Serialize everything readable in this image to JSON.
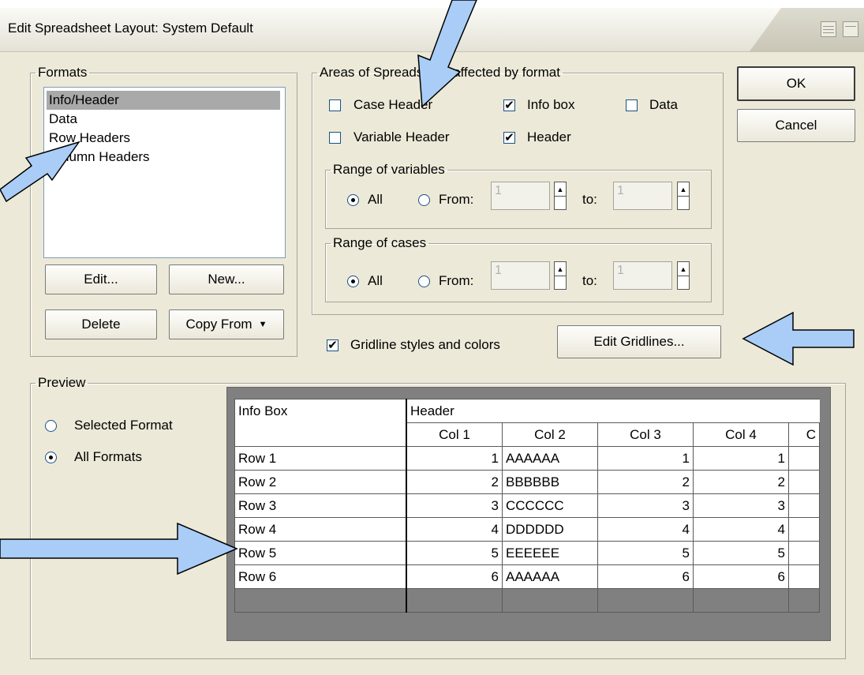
{
  "window": {
    "title": "Edit Spreadsheet Layout: System Default"
  },
  "formats": {
    "legend": "Formats",
    "items": [
      "Info/Header",
      "Data",
      "Row Headers",
      "Column Headers"
    ],
    "selected_index": 0,
    "buttons": {
      "edit": "Edit...",
      "new": "New...",
      "delete": "Delete",
      "copy_from": "Copy From"
    }
  },
  "areas": {
    "legend": "Areas of Spreadsheet affected by format",
    "checkboxes": [
      {
        "label": "Case Header",
        "checked": false
      },
      {
        "label": "Info box",
        "checked": true
      },
      {
        "label": "Data",
        "checked": false
      },
      {
        "label": "Variable Header",
        "checked": false
      },
      {
        "label": "Header",
        "checked": true
      }
    ],
    "range_variables": {
      "legend": "Range of variables",
      "all": "All",
      "from": "From:",
      "to": "to:",
      "from_value": "1",
      "to_value": "1"
    },
    "range_cases": {
      "legend": "Range of cases",
      "all": "All",
      "from": "From:",
      "to": "to:",
      "from_value": "1",
      "to_value": "1"
    }
  },
  "gridline": {
    "label": "Gridline styles and colors",
    "checked": true,
    "edit_button": "Edit Gridlines..."
  },
  "dialog_buttons": {
    "ok": "OK",
    "cancel": "Cancel"
  },
  "preview": {
    "legend": "Preview",
    "options": [
      "Selected Format",
      "All Formats"
    ],
    "selected_option": 1,
    "info_box": "Info Box",
    "header": "Header",
    "columns": [
      "Col 1",
      "Col 2",
      "Col 3",
      "Col 4",
      "C"
    ],
    "rows": [
      {
        "label": "Row 1",
        "c1": "1",
        "c2": "AAAAAA",
        "c3": "1",
        "c4": "1"
      },
      {
        "label": "Row 2",
        "c1": "2",
        "c2": "BBBBBB",
        "c3": "2",
        "c4": "2"
      },
      {
        "label": "Row 3",
        "c1": "3",
        "c2": "CCCCCC",
        "c3": "3",
        "c4": "3"
      },
      {
        "label": "Row 4",
        "c1": "4",
        "c2": "DDDDDD",
        "c3": "4",
        "c4": "4"
      },
      {
        "label": "Row 5",
        "c1": "5",
        "c2": "EEEEEE",
        "c3": "5",
        "c4": "5"
      },
      {
        "label": "Row 6",
        "c1": "6",
        "c2": "AAAAAA",
        "c3": "6",
        "c4": "6"
      }
    ]
  },
  "colors": {
    "dialog_bg": "#ece9d8",
    "arrow_fill": "#a9cdf7",
    "selection": "#a9a9a9"
  }
}
